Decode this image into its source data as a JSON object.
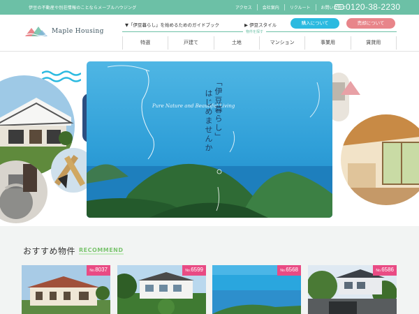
{
  "topbar": {
    "tagline": "伊豆の不動産や別荘情報のことならメープルハウジング",
    "links": [
      "アクセス",
      "会社案内",
      "リクルート",
      "お問い合わせ"
    ],
    "phone_icon": "free-dial-icon",
    "phone_icon_text": "FD",
    "phone": "0120-38-2230"
  },
  "header": {
    "logo_text": "Maple Housing",
    "guide_link": "▼「伊豆暮らし」を始めるためのガイドブック",
    "style_link": "▶ 伊豆スタイル",
    "search_label": "物件を探す",
    "buy_button": "購入について",
    "sell_button": "売却について",
    "nav": [
      "特選",
      "戸建て",
      "土地",
      "マンション",
      "事業用",
      "賃貸用"
    ]
  },
  "hero": {
    "catch_line1": "「伊豆暮らし」",
    "catch_line2": "はじめませんか",
    "script_text": "Pure Nature and Beautiful Living"
  },
  "recommend": {
    "title": "おすすめ物件",
    "subtitle": "RECOMMEND",
    "no_prefix": "No.",
    "cards": [
      {
        "no": "8037"
      },
      {
        "no": "6599"
      },
      {
        "no": "6568"
      },
      {
        "no": "6586"
      }
    ]
  },
  "colors": {
    "brand_green": "#6cc0a6",
    "buy_blue": "#2bbae0",
    "sell_pink": "#e8858a",
    "badge_pink": "#e94b84",
    "recommend_green": "#7bc46f"
  }
}
